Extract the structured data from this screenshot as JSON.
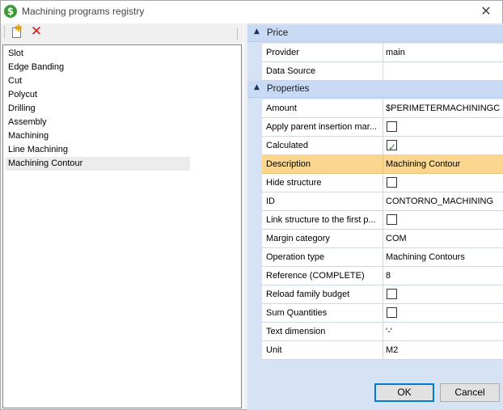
{
  "window": {
    "title": "Machining programs registry"
  },
  "toolbar": {
    "new_icon": "new-document-icon",
    "delete_icon": "delete-x-icon"
  },
  "list": {
    "items": [
      "Slot",
      "Edge Banding",
      "Cut",
      "Polycut",
      "Drilling",
      "Assembly",
      "Machining",
      "Line Machining",
      "Machining Contour"
    ],
    "selected": "Machining Contour"
  },
  "grid": {
    "categories": [
      {
        "label": "Price",
        "rows": [
          {
            "name": "Provider",
            "value": "main",
            "type": "text"
          },
          {
            "name": "Data Source",
            "value": "",
            "type": "text"
          }
        ]
      },
      {
        "label": "Properties",
        "rows": [
          {
            "name": "Amount",
            "value": "$PERIMETERMACHININGC",
            "type": "text"
          },
          {
            "name": "Apply parent insertion mar...",
            "value": false,
            "type": "checkbox"
          },
          {
            "name": "Calculated",
            "value": true,
            "type": "checkbox"
          },
          {
            "name": "Description",
            "value": "Machining Contour",
            "type": "text",
            "selected": true
          },
          {
            "name": "Hide structure",
            "value": false,
            "type": "checkbox"
          },
          {
            "name": "ID",
            "value": "CONTORNO_MACHINING",
            "type": "text"
          },
          {
            "name": "Link structure to the first p...",
            "value": false,
            "type": "checkbox"
          },
          {
            "name": "Margin category",
            "value": "COM",
            "type": "text"
          },
          {
            "name": "Operation type",
            "value": "Machining Contours",
            "type": "text"
          },
          {
            "name": "Reference (COMPLETE)",
            "value": "8",
            "type": "text"
          },
          {
            "name": "Reload family budget",
            "value": false,
            "type": "checkbox"
          },
          {
            "name": "Sum Quantities",
            "value": false,
            "type": "checkbox"
          },
          {
            "name": "Text dimension",
            "value": "'-'",
            "type": "text"
          },
          {
            "name": "Unit",
            "value": "M2",
            "type": "text"
          }
        ]
      }
    ]
  },
  "buttons": {
    "ok": "OK",
    "cancel": "Cancel"
  },
  "colors": {
    "selected_row": "#fad68e",
    "category_bg": "#c9daf4",
    "pane_bg": "#d6e3f5",
    "accent": "#0078d7"
  }
}
